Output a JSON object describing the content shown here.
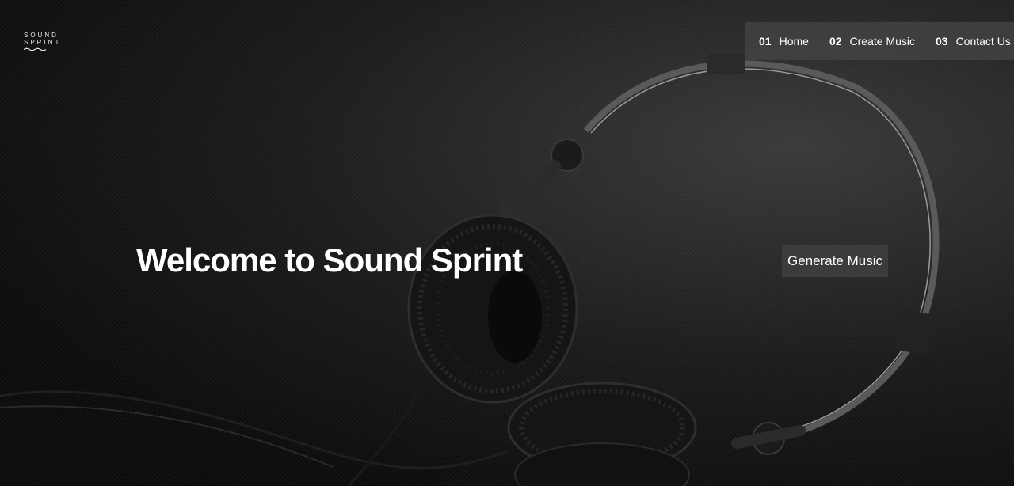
{
  "brand": {
    "line1": "SOUND",
    "line2": "SPRINT",
    "logo_icon": "wave-icon"
  },
  "nav": {
    "items": [
      {
        "number": "01",
        "label": "Home"
      },
      {
        "number": "02",
        "label": "Create Music"
      },
      {
        "number": "03",
        "label": "Contact Us"
      }
    ]
  },
  "hero": {
    "title": "Welcome to Sound Sprint",
    "cta_label": "Generate Music",
    "background_image": "headphones-photo"
  },
  "colors": {
    "background": "#111111",
    "nav_background": "#464646",
    "button_background": "#3c3c3c",
    "text": "#ffffff"
  }
}
